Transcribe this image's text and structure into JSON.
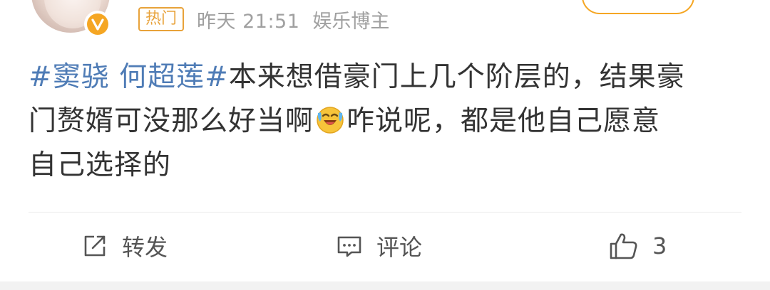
{
  "post": {
    "header": {
      "hot_tag": "热门",
      "time": "昨天 21:51",
      "source": "娱乐博主",
      "verified_color": "#f5a623",
      "avatar_icon": "avatar-icon",
      "verified_icon": "verified-v-icon"
    },
    "content": {
      "line1_topic": "#窦骁 何超莲#",
      "line1_text": "本来想借豪门上几个阶层的，结果豪",
      "line2_text_before_emoji": "门赘婿可没那么好当啊",
      "line2_emoji": "laugh-cry-emoji",
      "line2_text_after_emoji": "咋说呢，都是他自己愿意",
      "line3_text": "自己选择的",
      "topic_color": "#4f7cb6"
    },
    "actions": {
      "repost_label": "转发",
      "comment_label": "评论",
      "like_count": "3",
      "repost_icon": "repost-icon",
      "comment_icon": "comment-icon",
      "like_icon": "thumbs-up-icon"
    }
  }
}
